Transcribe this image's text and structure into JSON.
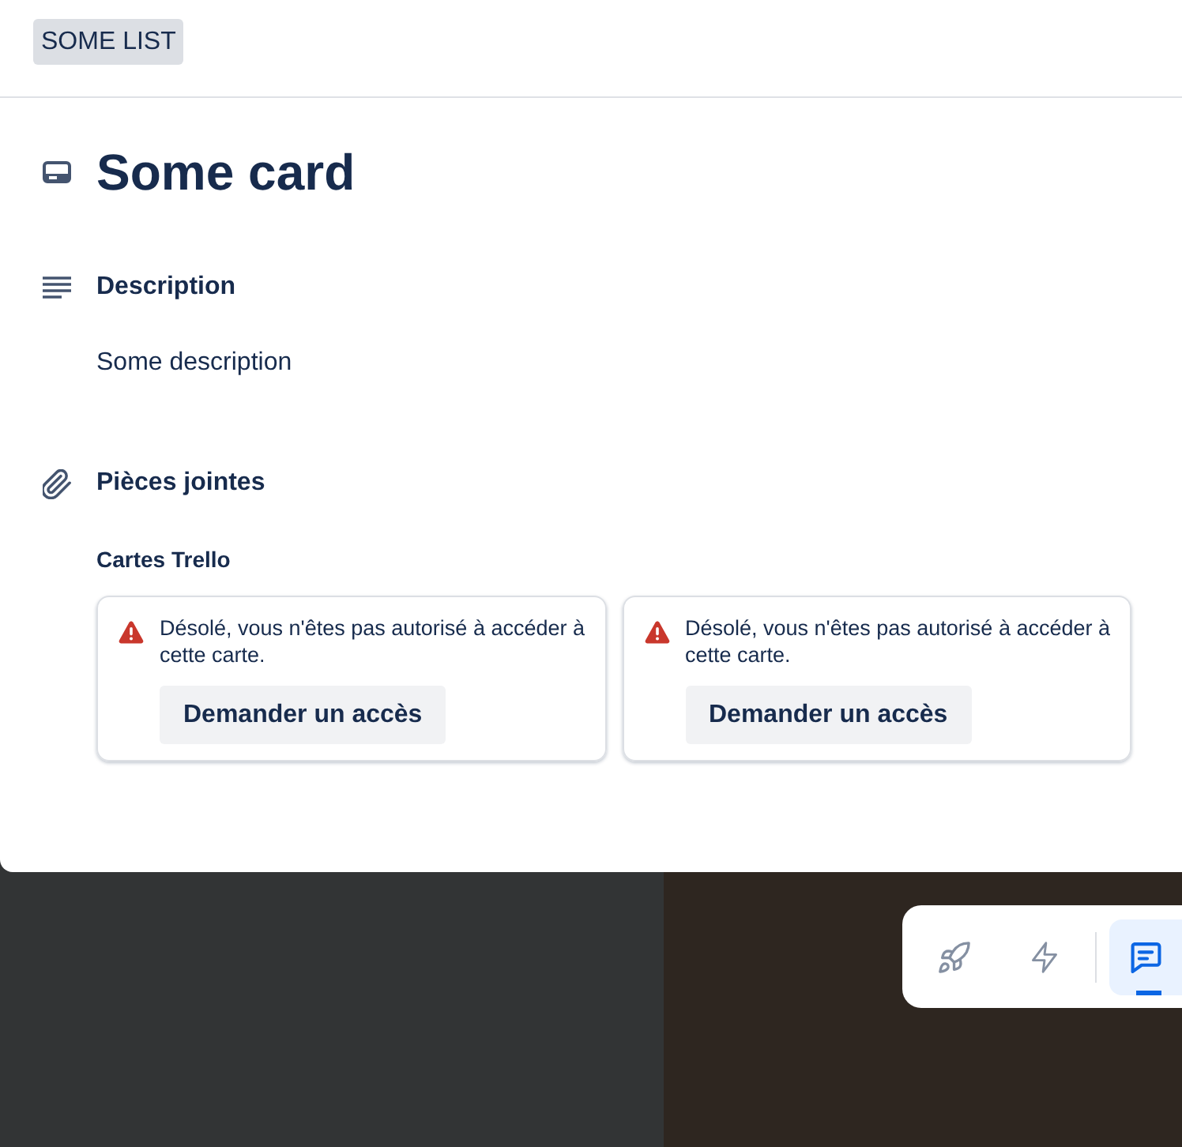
{
  "list_badge": "SOME LIST",
  "card": {
    "title": "Some card"
  },
  "description": {
    "heading": "Description",
    "text": "Some description"
  },
  "attachments": {
    "heading": "Pièces jointes",
    "group_label": "Cartes Trello",
    "items": [
      {
        "message": "Désolé, vous n'êtes pas autorisé à accéder à cette carte.",
        "button": "Demander un accès"
      },
      {
        "message": "Désolé, vous n'êtes pas autorisé à accéder à cette carte.",
        "button": "Demander un accès"
      }
    ]
  },
  "toolbar": {
    "buttons": [
      {
        "kind": "rocket",
        "selected": false
      },
      {
        "kind": "lightning",
        "selected": false
      },
      {
        "kind": "message",
        "selected": true
      }
    ]
  }
}
